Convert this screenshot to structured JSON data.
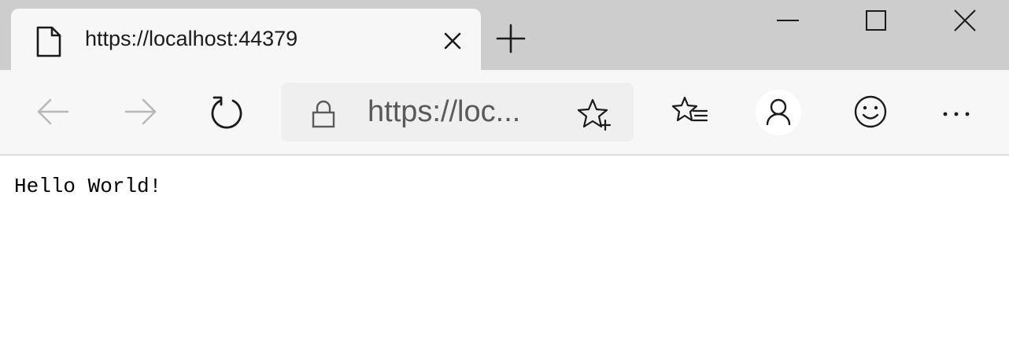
{
  "window": {
    "tab": {
      "title": "https://localhost:44379",
      "icon": "page-icon"
    },
    "new_tab_icon": "plus-icon",
    "controls": [
      "minimize-icon",
      "maximize-icon",
      "close-icon"
    ]
  },
  "toolbar": {
    "back_icon": "arrow-left-icon",
    "forward_icon": "arrow-right-icon",
    "refresh_icon": "refresh-icon",
    "address": {
      "display_text": "https://loc...",
      "lock_icon": "lock-icon",
      "favorite_icon": "star-add-icon"
    },
    "favorites_icon": "favorites-list-icon",
    "profile_icon": "person-icon",
    "feedback_icon": "smiley-icon",
    "more_icon": "ellipsis-icon"
  },
  "page": {
    "body_text": "Hello World!"
  },
  "colors": {
    "tabstrip_bg": "#cdcdcd",
    "toolbar_bg": "#f7f7f7",
    "omnibox_bg": "#efefef",
    "icon_color": "#1b1b1b",
    "disabled_icon_color": "#b8b8b8"
  }
}
